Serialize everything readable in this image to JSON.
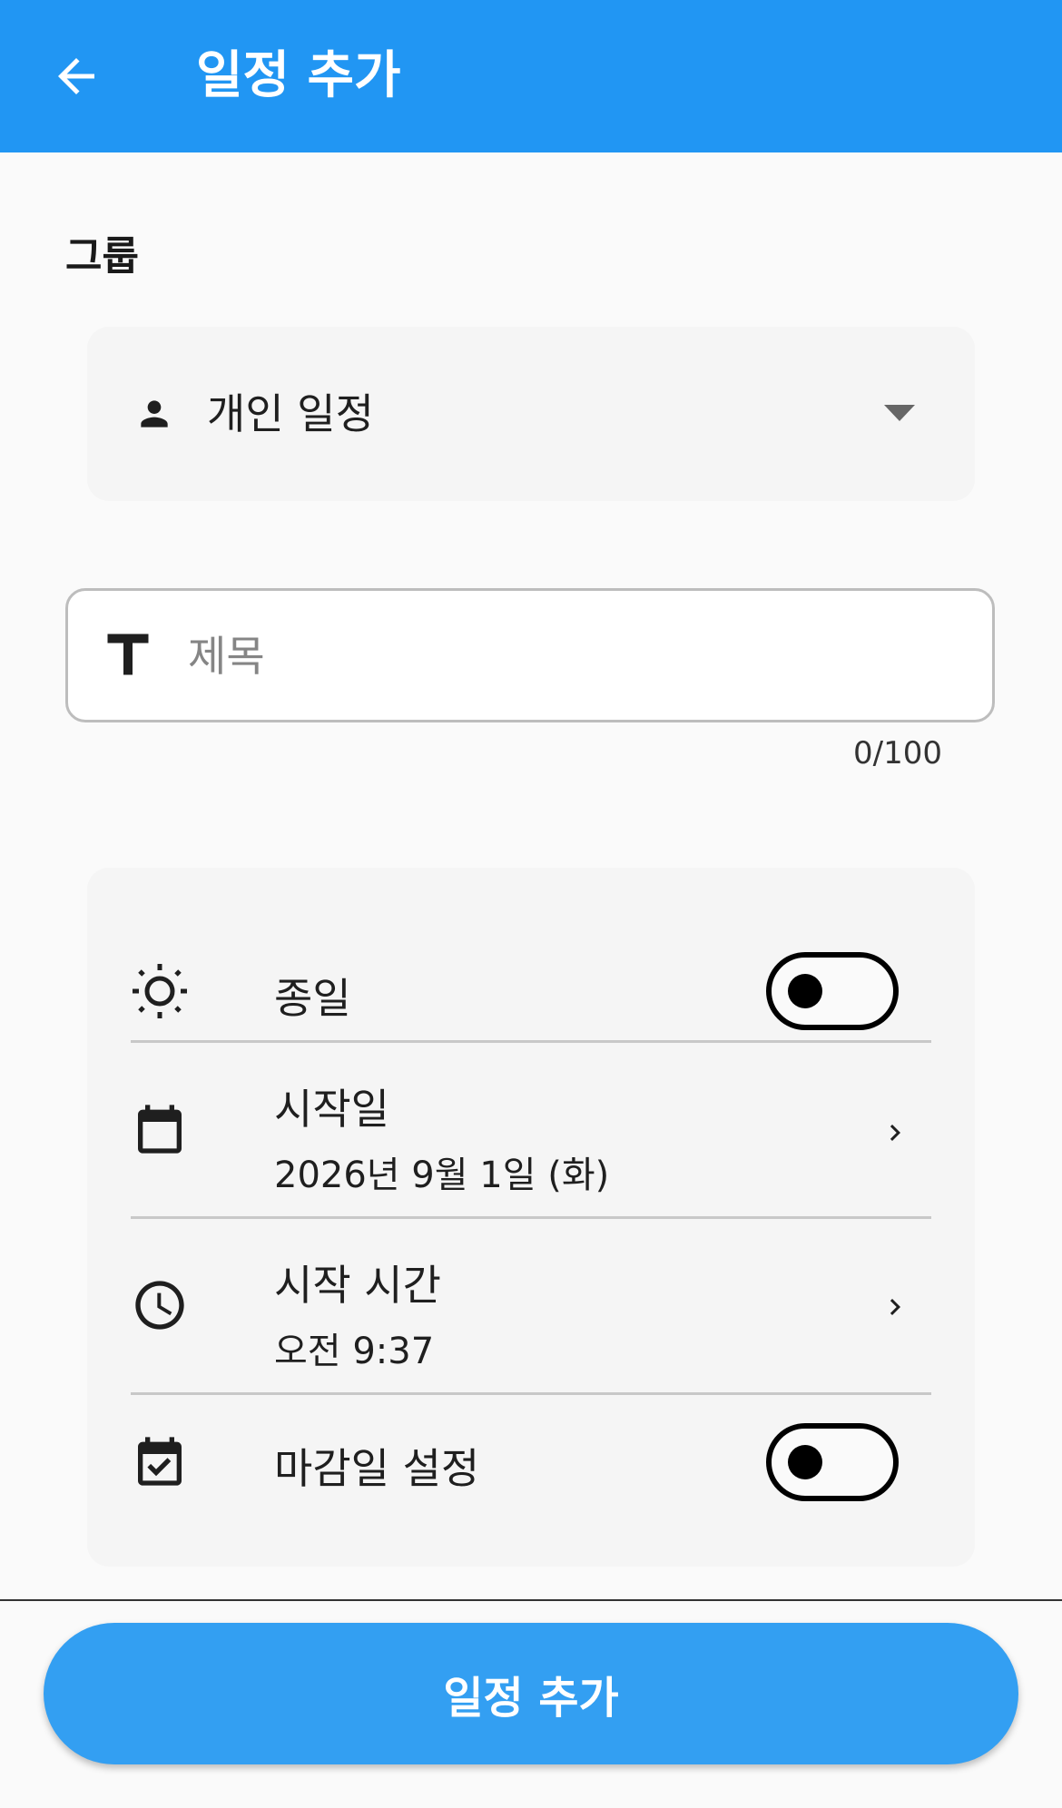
{
  "appbar": {
    "title": "일정 추가",
    "back_icon": "arrow-back-icon",
    "color": "#2196f3"
  },
  "group": {
    "label": "그룹",
    "value": "개인 일정",
    "icon": "person-icon",
    "dropdown_icon": "dropdown-arrow-icon"
  },
  "title_input": {
    "placeholder": "제목",
    "value": "",
    "counter": "0/100",
    "icon": "text-t-icon"
  },
  "settings": {
    "all_day": {
      "label": "종일",
      "icon": "sun-icon",
      "enabled": false
    },
    "start_date": {
      "label": "시작일",
      "value": "2026년 9월 1일 (화)",
      "icon": "calendar-icon"
    },
    "start_time": {
      "label": "시작 시간",
      "value": "오전 9:37",
      "icon": "clock-icon"
    },
    "deadline": {
      "label": "마감일 설정",
      "icon": "calendar-check-icon",
      "enabled": false
    }
  },
  "submit": {
    "label": "일정 추가",
    "color": "#339ff2"
  }
}
